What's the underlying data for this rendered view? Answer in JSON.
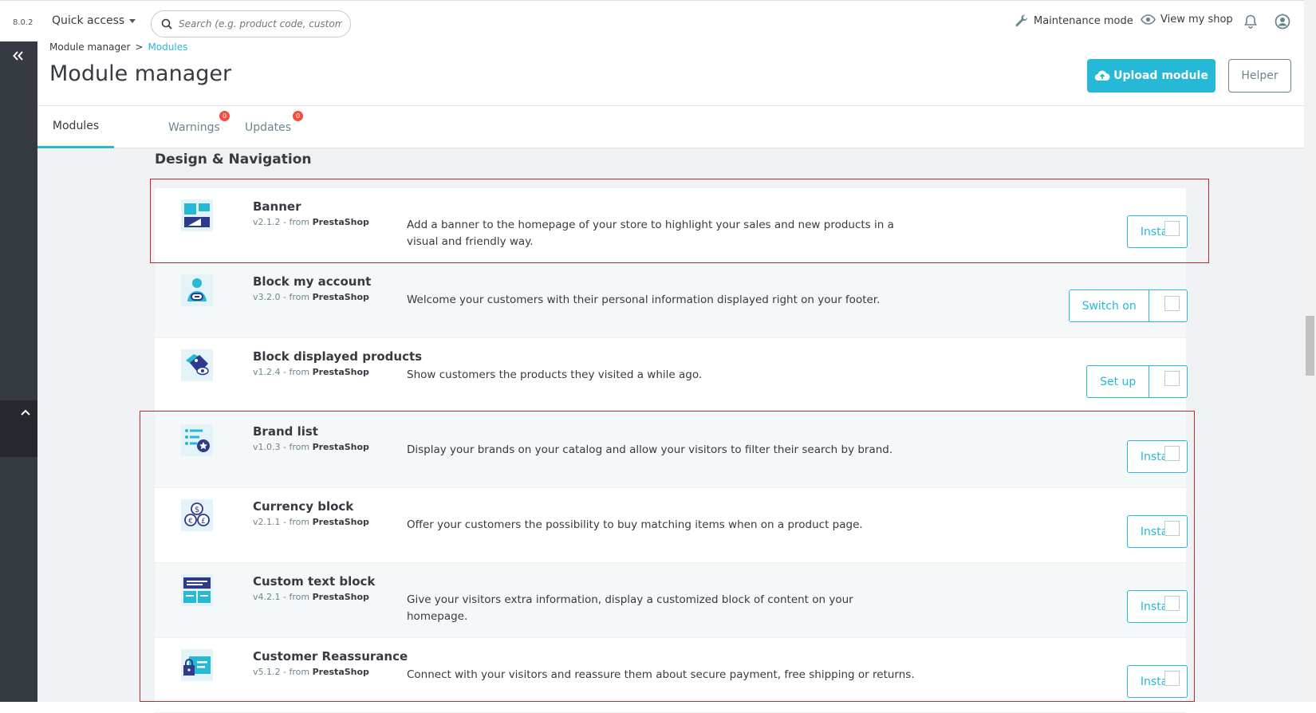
{
  "topbar": {
    "version": "8.0.2",
    "quick_access": "Quick access",
    "search_placeholder": "Search (e.g. product code, customer name…)",
    "maintenance": "Maintenance mode",
    "view_shop": "View my shop"
  },
  "header": {
    "breadcrumb_parent": "Module manager",
    "breadcrumb_sep": ">",
    "breadcrumb_current": "Modules",
    "title": "Module manager",
    "upload_label": "Upload module",
    "helper_label": "Helper"
  },
  "tabs": [
    {
      "label": "Modules"
    },
    {
      "label": "Warnings",
      "badge": "0"
    },
    {
      "label": "Updates",
      "badge": "0"
    }
  ],
  "section_title": "Design & Navigation",
  "modules": [
    {
      "name": "Banner",
      "version": "v2.1.2 - from",
      "vendor": "PrestaShop",
      "description": "Add a banner to the homepage of your store to highlight your sales and new products in a visual and friendly way.",
      "action": "Install",
      "icon": "banner-icon"
    },
    {
      "name": "Block my account",
      "version": "v3.2.0 - from",
      "vendor": "PrestaShop",
      "description": "Welcome your customers with their personal information displayed right on your footer.",
      "action": "Switch on",
      "icon": "account-icon"
    },
    {
      "name": "Block displayed products",
      "version": "v1.2.4 - from",
      "vendor": "PrestaShop",
      "description": "Show customers the products they visited a while ago.",
      "action": "Set up",
      "icon": "viewed-products-icon"
    },
    {
      "name": "Brand list",
      "version": "v1.0.3 - from",
      "vendor": "PrestaShop",
      "description": "Display your brands on your catalog and allow your visitors to filter their search by brand.",
      "action": "Install",
      "icon": "brand-list-icon"
    },
    {
      "name": "Currency block",
      "version": "v2.1.1 - from",
      "vendor": "PrestaShop",
      "description": "Offer your customers the possibility to buy matching items when on a product page.",
      "action": "Install",
      "icon": "currency-icon"
    },
    {
      "name": "Custom text block",
      "version": "v4.2.1 - from",
      "vendor": "PrestaShop",
      "description": "Give your visitors extra information, display a customized block of content on your homepage.",
      "action": "Install",
      "icon": "custom-text-icon"
    },
    {
      "name": "Customer Reassurance",
      "version": "v5.1.2 - from",
      "vendor": "PrestaShop",
      "description": "Connect with your visitors and reassure them about secure payment, free shipping or returns.",
      "action": "Install",
      "icon": "reassurance-icon"
    }
  ],
  "colors": {
    "accent": "#25b9d7",
    "sidebar": "#363a41",
    "badge": "#f54c3e",
    "highlight": "#c5262d"
  }
}
